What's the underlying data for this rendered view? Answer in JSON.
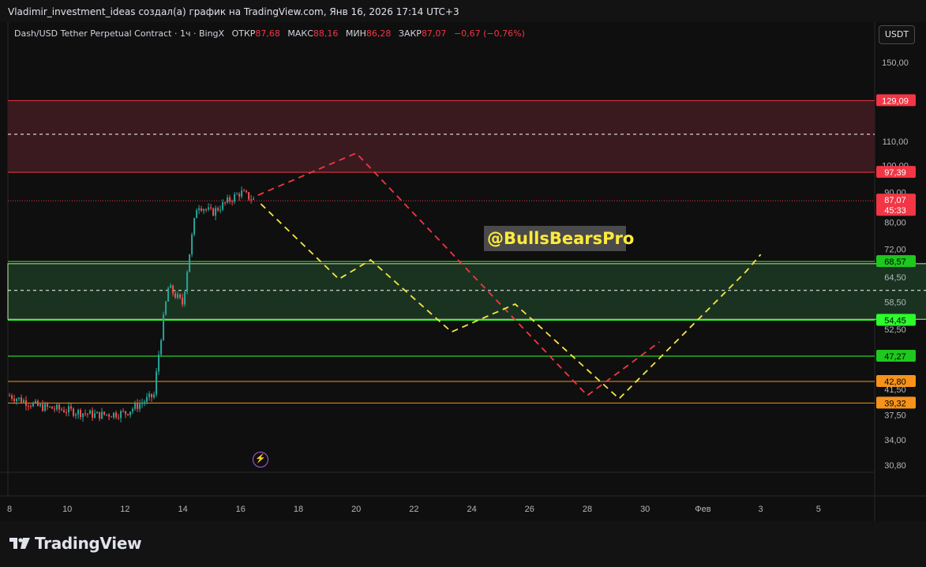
{
  "header": {
    "title": "Vladimir_investment_ideas создал(а) график на TradingView.com, Янв 16, 2026 17:14 UTC+3"
  },
  "symbol": {
    "name": "Dash/USD Tether Perpetual Contract · 1ч · BingX",
    "open_label": "ОТКР",
    "open": "87,68",
    "high_label": "МАКС",
    "high": "88,16",
    "low_label": "МИН",
    "low": "86,28",
    "close_label": "ЗАКР",
    "close": "87,07",
    "change": "−0,67 (−0,76%)"
  },
  "currency_button": "USDT",
  "watermark_text": "@BullsBearsPro",
  "bolt_icon_glyph": "⚡",
  "footer": {
    "brand": "TradingView"
  },
  "price_axis": {
    "ticks": [
      "150,00",
      "110,00",
      "100,00",
      "90,00",
      "80,00",
      "72,00",
      "64,50",
      "58,50",
      "52,50",
      "41,50",
      "37,50",
      "34,00",
      "30,80"
    ],
    "tick_values": [
      150,
      110,
      100,
      90,
      80,
      72,
      64.5,
      58.5,
      52.5,
      41.5,
      37.5,
      34,
      30.8
    ]
  },
  "price_labels": [
    {
      "text": "129,09",
      "value": 129.09,
      "bg": "#f23645",
      "fg": "#ffffff"
    },
    {
      "text": "97,39",
      "value": 97.39,
      "bg": "#f23645",
      "fg": "#ffffff"
    },
    {
      "text": "87,07",
      "sub": "45:33",
      "value": 87.07,
      "bg": "#f23645",
      "fg": "#ffffff"
    },
    {
      "text": "68,57",
      "value": 68.57,
      "bg": "#1ec81e",
      "fg": "#000000"
    },
    {
      "text": "54,45",
      "value": 54.45,
      "bg": "#2bff2b",
      "fg": "#000000"
    },
    {
      "text": "47,27",
      "value": 47.27,
      "bg": "#1ec81e",
      "fg": "#000000"
    },
    {
      "text": "42,80",
      "value": 42.8,
      "bg": "#f7931a",
      "fg": "#000000"
    },
    {
      "text": "39,32",
      "value": 39.32,
      "bg": "#f7931a",
      "fg": "#000000"
    }
  ],
  "time_axis": {
    "labels": [
      "8",
      "10",
      "12",
      "14",
      "16",
      "18",
      "20",
      "22",
      "24",
      "26",
      "28",
      "30",
      "Фев",
      "3",
      "5"
    ],
    "day_index": [
      0,
      2,
      4,
      6,
      8,
      10,
      12,
      14,
      16,
      18,
      20,
      22,
      24,
      26,
      28
    ]
  },
  "colors": {
    "up": "#26a69a",
    "down": "#ef5350",
    "resistance_zone": "#3a1a1f",
    "support_zone": "#1a3320",
    "red_line": "#f23645",
    "green_line": "#2bff2b",
    "orange_line": "#f7931a",
    "path_red": "#f23645",
    "path_yellow": "#f5e642"
  },
  "chart_data": {
    "type": "candlestick",
    "interval": "1h",
    "zones": [
      {
        "name": "resistance",
        "from": 97.39,
        "to": 129.09,
        "mid": 113.1
      },
      {
        "name": "support",
        "from": 54.45,
        "to": 68.57,
        "mid": 61.2
      }
    ],
    "horizontal_levels": [
      {
        "value": 129.09,
        "color": "red"
      },
      {
        "value": 97.39,
        "color": "red"
      },
      {
        "value": 68.57,
        "color": "green"
      },
      {
        "value": 54.45,
        "color": "green"
      },
      {
        "value": 47.27,
        "color": "green"
      },
      {
        "value": 42.8,
        "color": "orange"
      },
      {
        "value": 39.32,
        "color": "orange"
      }
    ],
    "last_price": 87.07,
    "price_history_day_close": [
      {
        "day": "8",
        "price": 40.5
      },
      {
        "day": "9",
        "price": 38.8
      },
      {
        "day": "10",
        "price": 38.2
      },
      {
        "day": "11",
        "price": 37.5
      },
      {
        "day": "12",
        "price": 37.8
      },
      {
        "day": "13",
        "price": 40.5
      },
      {
        "day": "13.5",
        "price": 62.0
      },
      {
        "day": "14",
        "price": 58.0
      },
      {
        "day": "14.5",
        "price": 86.0
      },
      {
        "day": "15",
        "price": 83.0
      },
      {
        "day": "16",
        "price": 90.0
      },
      {
        "day": "16.5",
        "price": 87.07
      }
    ],
    "projection_paths": [
      {
        "name": "bullish-first",
        "color": "red",
        "points": [
          {
            "day": 16.6,
            "price": 89
          },
          {
            "day": 20,
            "price": 105
          },
          {
            "day": 28,
            "price": 40.5
          },
          {
            "day": 30.5,
            "price": 50
          }
        ]
      },
      {
        "name": "bearish-first",
        "color": "yellow",
        "points": [
          {
            "day": 16.7,
            "price": 86
          },
          {
            "day": 19.4,
            "price": 64
          },
          {
            "day": 20.5,
            "price": 69
          },
          {
            "day": 23.3,
            "price": 52
          },
          {
            "day": 25.5,
            "price": 58
          },
          {
            "day": 29.1,
            "price": 40
          },
          {
            "day": 33.5,
            "price": 66
          },
          {
            "day": 34,
            "price": 70.5
          }
        ]
      }
    ]
  }
}
